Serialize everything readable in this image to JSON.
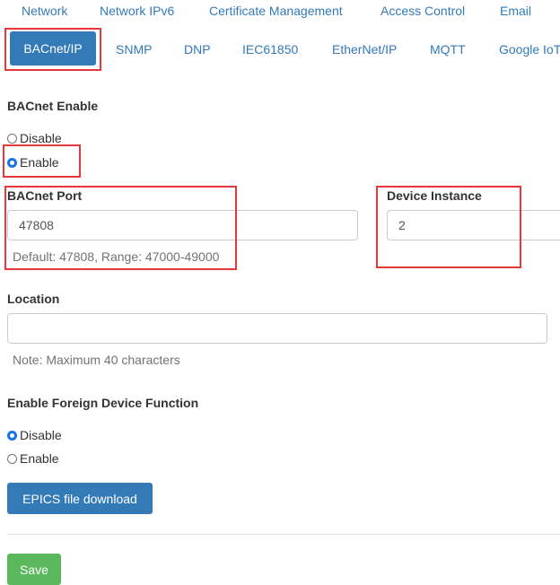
{
  "top_nav": [
    "Network",
    "Network IPv6",
    "Certificate Management",
    "Access Control",
    "Email"
  ],
  "tabs": [
    "BACnet/IP",
    "SNMP",
    "DNP",
    "IEC61850",
    "EtherNet/IP",
    "MQTT",
    "Google IoT"
  ],
  "active_tab": "BACnet/IP",
  "bacnet_enable": {
    "label": "BACnet Enable",
    "options": [
      "Disable",
      "Enable"
    ],
    "selected": "Enable"
  },
  "bacnet_port": {
    "label": "BACnet Port",
    "value": "47808",
    "hint": "Default: 47808, Range: 47000-49000"
  },
  "device_instance": {
    "label": "Device Instance",
    "value": "2"
  },
  "location": {
    "label": "Location",
    "value": "",
    "hint": "Note: Maximum 40 characters"
  },
  "foreign_device": {
    "label": "Enable Foreign Device Function",
    "options": [
      "Disable",
      "Enable"
    ],
    "selected": "Disable"
  },
  "buttons": {
    "epics": "EPICS file download",
    "save": "Save"
  },
  "colors": {
    "link": "#337ab7",
    "primary": "#337ab7",
    "success": "#5cb85c",
    "highlight": "#e5383b",
    "radio_checked": "#1a73e8"
  }
}
